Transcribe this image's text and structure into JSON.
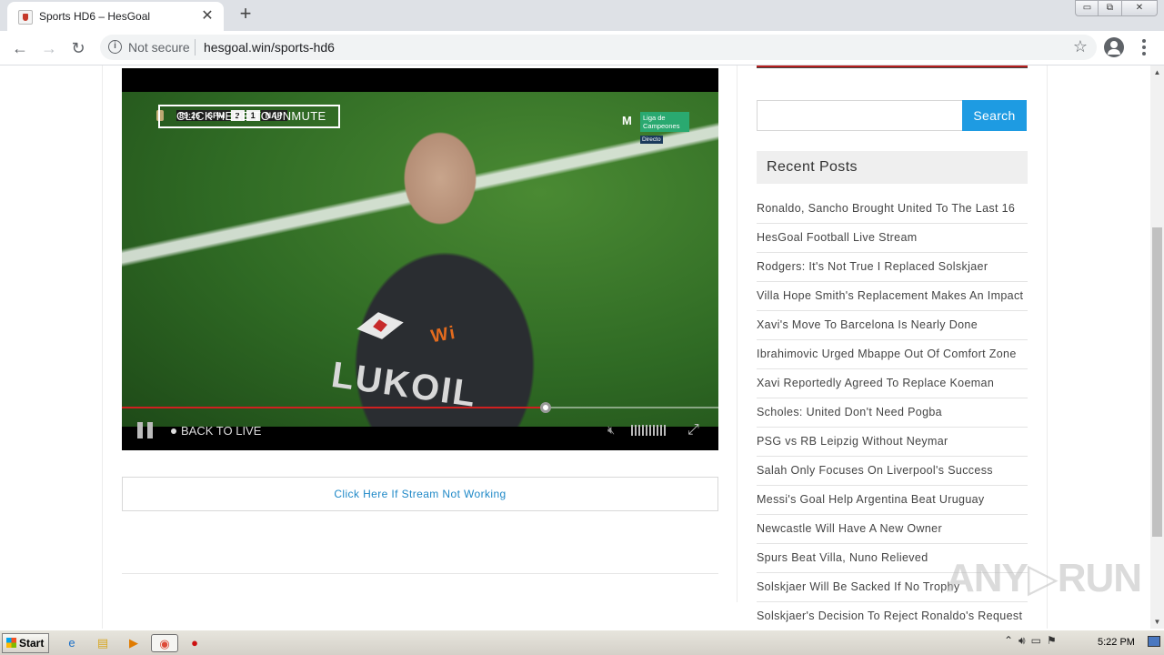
{
  "browser": {
    "tab_title": "Sports HD6 – HesGoal",
    "tab_close": "✕",
    "new_tab": "+",
    "security_label": "Not secure",
    "url": "hesgoal.win/sports-hd6",
    "window_min": "▭",
    "window_max": "⧉",
    "window_close": "✕"
  },
  "player": {
    "unmute_label": "CLICK HERE TO UNMUTE",
    "scorebug": {
      "time": "89:26",
      "home": "SPM",
      "home_score": "2",
      "away_score": "1",
      "away": "NAP"
    },
    "broadcaster": {
      "logo": "M",
      "name": "Liga de Campeones",
      "tag": "Directo"
    },
    "jersey_text": "LUKOIL",
    "sponsor_text": "Wi",
    "back_to_live": "BACK TO LIVE",
    "progress_fraction": 0.71
  },
  "stream_link": "Click Here If Stream Not Working",
  "sidebar": {
    "search_placeholder": "",
    "search_button": "Search",
    "recent_title": "Recent Posts",
    "recent_posts": [
      "Ronaldo, Sancho Brought United To The Last 16",
      "HesGoal Football Live Stream",
      "Rodgers: It's Not True I Replaced Solskjaer",
      "Villa Hope Smith's Replacement Makes An Impact",
      "Xavi's Move To Barcelona Is Nearly Done",
      "Ibrahimovic Urged Mbappe Out Of Comfort Zone",
      "Xavi Reportedly Agreed To Replace Koeman",
      "Scholes: United Don't Need Pogba",
      "PSG vs RB Leipzig Without Neymar",
      "Salah Only Focuses On Liverpool's Success",
      "Messi's Goal Help Argentina Beat Uruguay",
      "Newcastle Will Have A New Owner",
      "Spurs Beat Villa, Nuno Relieved",
      "Solskjaer Will Be Sacked If No Trophy",
      "Solskjaer's Decision To Reject Ronaldo's Request"
    ]
  },
  "watermark": "ANY▷RUN",
  "taskbar": {
    "start_label": "Start",
    "clock": "5:22 PM"
  }
}
